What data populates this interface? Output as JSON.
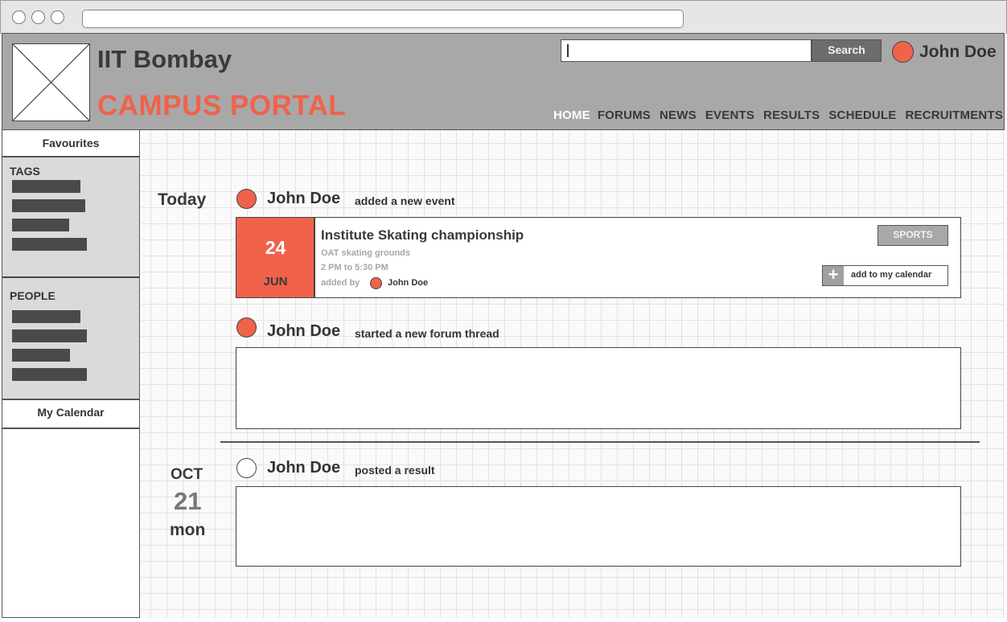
{
  "header": {
    "brand_name": "IIT Bombay",
    "portal_name": "CAMPUS PORTAL",
    "search_value": "",
    "search_button": "Search",
    "user_name": "John Doe",
    "accent_color": "#f0624a",
    "nav": [
      {
        "label": "HOME",
        "active": true
      },
      {
        "label": "FORUMS",
        "active": false
      },
      {
        "label": "NEWS",
        "active": false
      },
      {
        "label": "EVENTS",
        "active": false
      },
      {
        "label": "RESULTS",
        "active": false
      },
      {
        "label": "SCHEDULE",
        "active": false
      },
      {
        "label": "RECRUITMENTS",
        "active": false
      }
    ]
  },
  "sidebar": {
    "favourites": "Favourites",
    "tags_label": "TAGS",
    "people_label": "PEOPLE",
    "calendar": "My Calendar"
  },
  "feed": {
    "today_label": "Today",
    "items": [
      {
        "user": "John Doe",
        "action": "added a new event",
        "event": {
          "day": "24",
          "month": "JUN",
          "title": "Institute Skating championship",
          "location": "OAT skating grounds",
          "time": "2 PM to 5:30 PM",
          "added_by_label": "added by",
          "added_by": "John Doe",
          "tag": "SPORTS",
          "calendar_button": "add to my calendar"
        }
      },
      {
        "user": "John Doe",
        "action": "started a new forum thread"
      },
      {
        "user": "John Doe",
        "action": "posted a result"
      }
    ],
    "date_group": {
      "month": "OCT",
      "day": "21",
      "weekday": "mon"
    }
  }
}
